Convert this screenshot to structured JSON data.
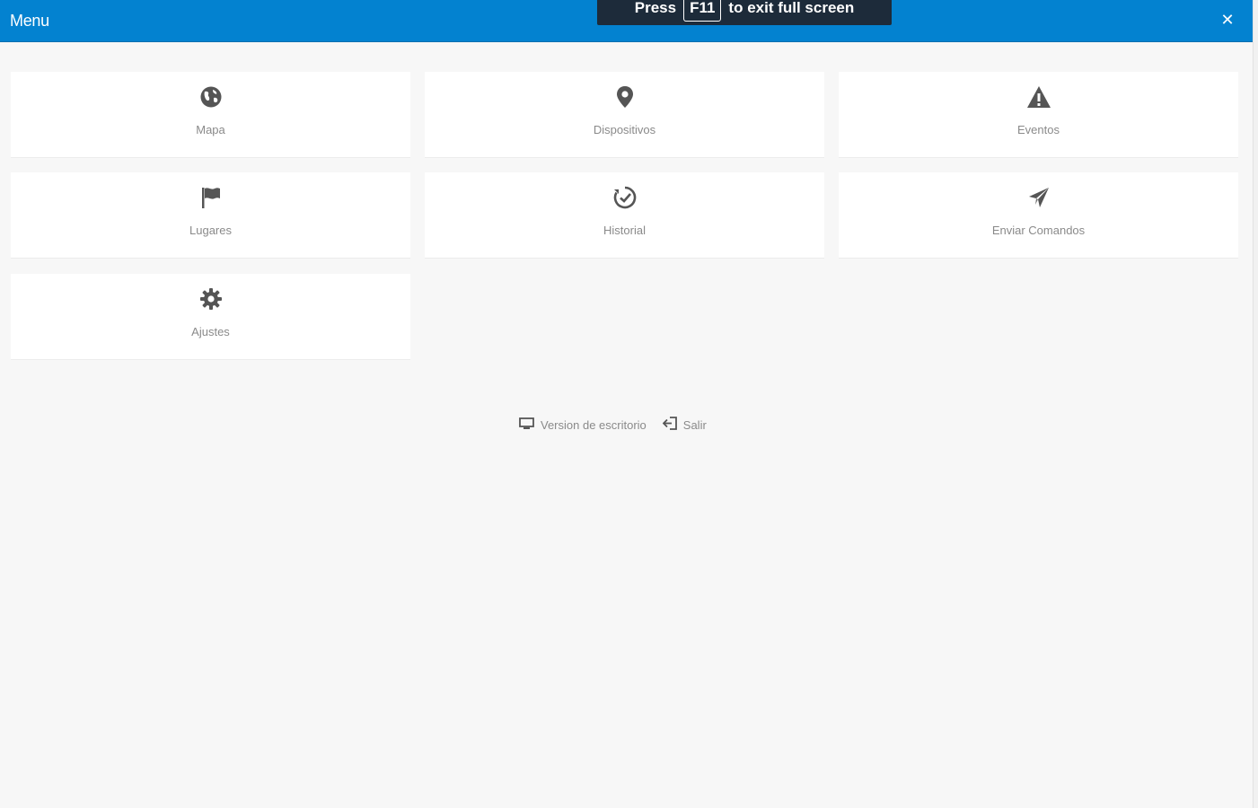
{
  "header": {
    "title": "Menu",
    "close_icon": "close-icon",
    "accent_color": "#0382d0"
  },
  "fullscreen_notice": {
    "prefix": "Press",
    "key": "F11",
    "suffix": "to exit full screen"
  },
  "tiles": [
    {
      "label": "Mapa",
      "icon": "globe-icon"
    },
    {
      "label": "Dispositivos",
      "icon": "map-pin-icon"
    },
    {
      "label": "Eventos",
      "icon": "warning-icon"
    },
    {
      "label": "Lugares",
      "icon": "flag-icon"
    },
    {
      "label": "Historial",
      "icon": "history-clock-icon"
    },
    {
      "label": "Enviar Comandos",
      "icon": "send-icon"
    },
    {
      "label": "Ajustes",
      "icon": "gear-icon"
    }
  ],
  "footer": {
    "desktop_label": "Version de escritorio",
    "desktop_icon": "monitor-icon",
    "logout_label": "Salir",
    "logout_icon": "sign-out-icon"
  },
  "colors": {
    "background": "#f7f7f7",
    "tile": "#ffffff",
    "icon": "#555555",
    "label": "#8a8a8a"
  }
}
